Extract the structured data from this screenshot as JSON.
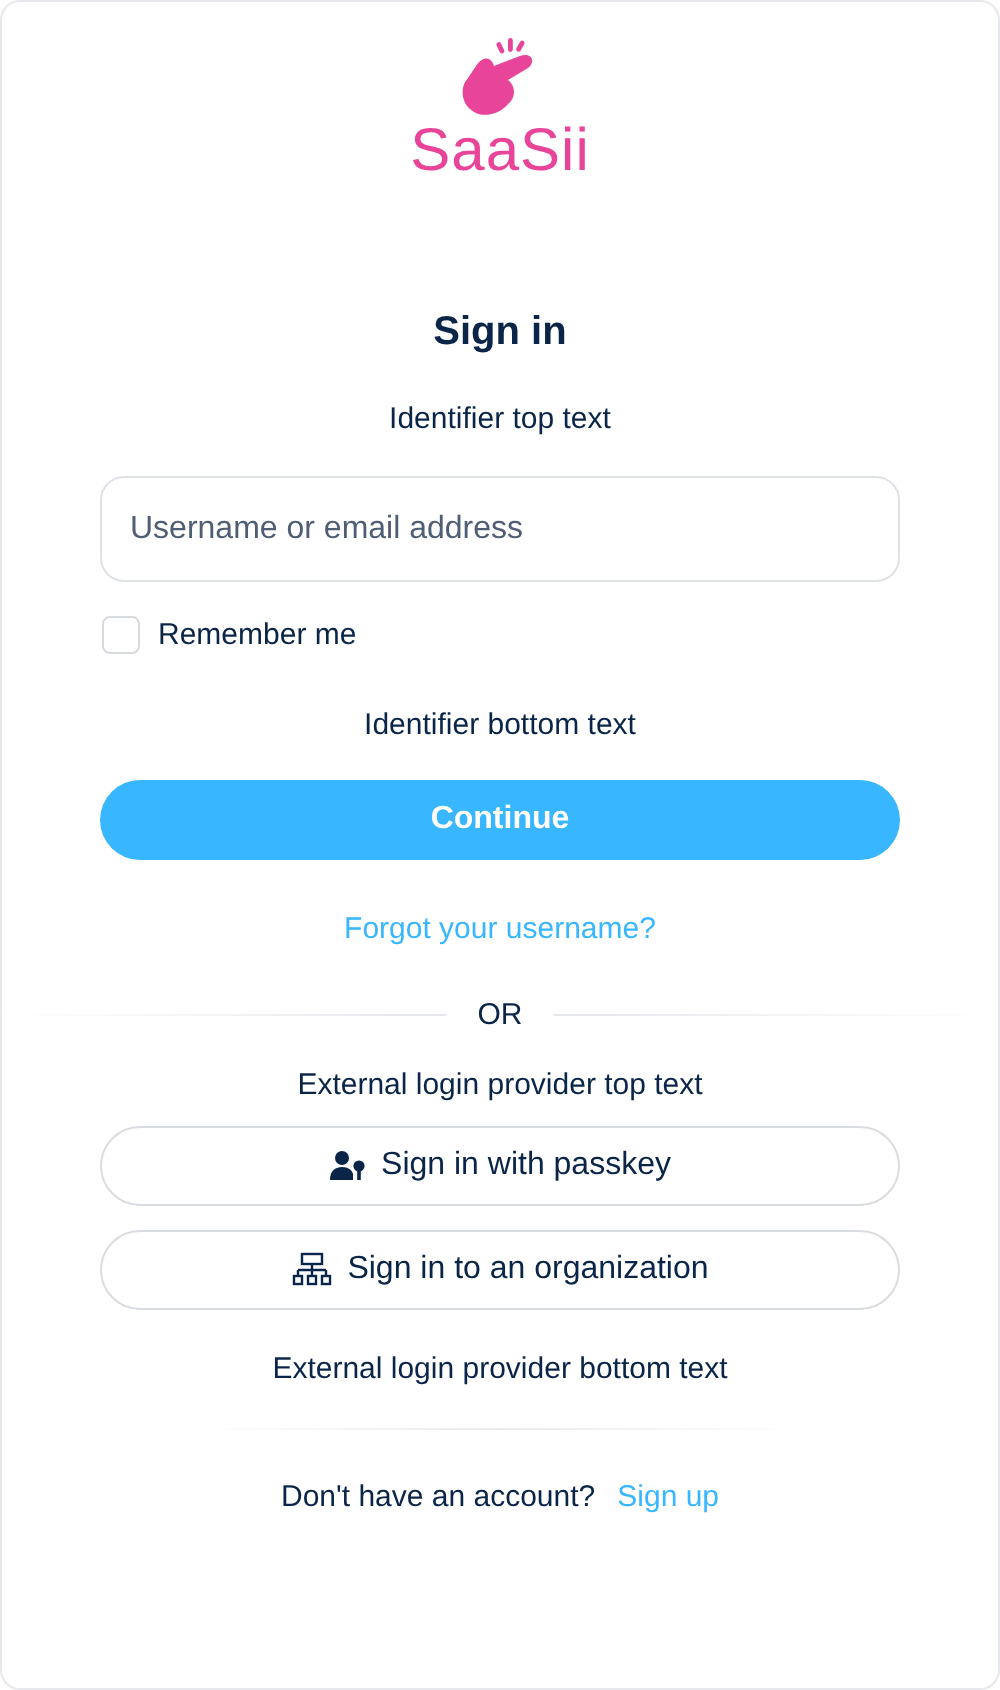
{
  "logo": {
    "text": "SaaSii"
  },
  "title": "Sign in",
  "identifier_top_text": "Identifier top text",
  "username_field": {
    "placeholder": "Username or email address"
  },
  "remember_me": {
    "label": "Remember me",
    "checked": false
  },
  "identifier_bottom_text": "Identifier bottom text",
  "continue_button": "Continue",
  "forgot_link": "Forgot your username?",
  "separator": "OR",
  "external_top_text": "External login provider top text",
  "providers": [
    {
      "kind": "passkey",
      "label": "Sign in with passkey"
    },
    {
      "kind": "organization",
      "label": "Sign in to an organization"
    }
  ],
  "external_bottom_text": "External login provider bottom text",
  "signup": {
    "prompt": "Don't have an account?",
    "link": "Sign up"
  }
}
